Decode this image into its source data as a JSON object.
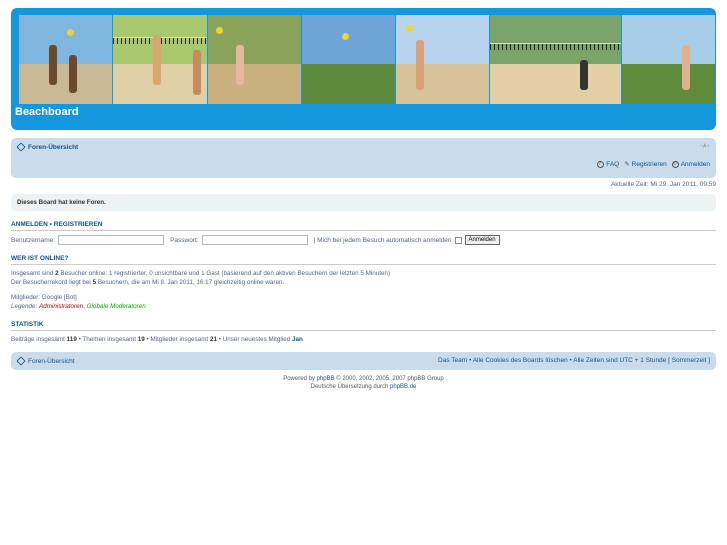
{
  "site": {
    "title": "Beachboard"
  },
  "navbar": {
    "home_label": "Foren-Übersicht",
    "faq_label": "FAQ",
    "register_label": "Registrieren",
    "login_label": "Anmelden"
  },
  "time_text": "Aktuelle Zeit: Mi 29. Jan 2011, 09:59",
  "notice": "Dieses Board hat keine Foren.",
  "login": {
    "heading_login": "Anmelden",
    "heading_sep": "•",
    "heading_register": "Registrieren",
    "username_label": "Benutzername:",
    "username_value": "",
    "password_label": "Passwort:",
    "password_value": "",
    "auto_label": "| Mich bei jedem Besuch automatisch anmelden",
    "submit_label": "Anmelden"
  },
  "online": {
    "heading": "Wer ist online?",
    "line1_pre": "Insgesamt sind ",
    "line1_count": "2",
    "line1_post": " Besucher online: 1 registrierter, 0 unsichtbare und 1 Gast (basierend auf den aktiven Besuchern der letzten 5 Minuten)",
    "line2_pre": "Der Besucherrekord liegt bei ",
    "line2_count": "5",
    "line2_post": " Besuchern, die am Mi 8. Jan 2011, 16:17 gleichzeitig online waren.",
    "members": "Mitglieder: Google [Bot]",
    "legend_label": "Legende:",
    "legend_admin": "Administratoren",
    "legend_sep": ",",
    "legend_mod": "Globale Moderatoren"
  },
  "stats": {
    "heading": "Statistik",
    "posts_label": "Beiträge insgesamt ",
    "posts": "119",
    "topics_label": " • Themen insgesamt ",
    "topics": "19",
    "members_label": " • Mitglieder insgesamt ",
    "members": "21",
    "newest_label": " • Unser neuestes Mitglied ",
    "newest": "Jan"
  },
  "footer": {
    "home_label": "Foren-Übersicht",
    "links": "Das Team • Alle Cookies des Boards löschen • Alle Zeiten sind UTC + 1 Stunde [ Sommerzeit ]",
    "powered_pre": "Powered by ",
    "powered_link": "phpBB",
    "powered_post": " © 2000, 2002, 2005, 2007 phpBB Group",
    "translation_pre": "Deutsche Übersetzung durch ",
    "translation_link": "phpBB.de"
  },
  "colors": {
    "header_blue": "#1497dd",
    "nav_bg": "#cadceb",
    "link": "#105289"
  },
  "icons": [
    "home-icon",
    "faq-icon",
    "register-icon",
    "login-icon",
    "resize-icon"
  ]
}
